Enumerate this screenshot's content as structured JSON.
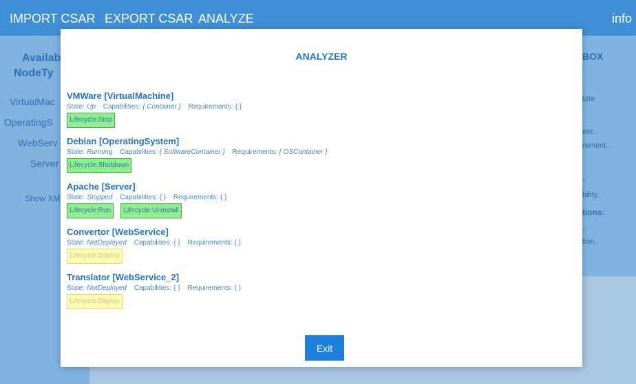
{
  "menu": {
    "import_label": "IMPORT CSAR",
    "export_label": "EXPORT CSAR",
    "analyze_label": "ANALYZE",
    "info_label": "info"
  },
  "left_panel": {
    "title_line1": "Availab",
    "title_line2": "NodeTy",
    "node_types": [
      "VirtualMac",
      "OperatingS",
      "WebServ",
      "Server"
    ],
    "show_xml_label": "Show XM"
  },
  "right_panel": {
    "title": "BOX",
    "items": [
      "tate",
      "ent..",
      "rement..",
      "..",
      "bility..",
      "tions:",
      "..",
      "tion.."
    ]
  },
  "modal": {
    "title": "ANALYZER",
    "state_label": "State:",
    "capabilities_label": "Capabilities:",
    "requirements_label": "Requirements:",
    "nodes": [
      {
        "name": "VMWare [VirtualMachine]",
        "state": "Up",
        "capabilities": "{ Container }",
        "requirements": "{ }",
        "actions": [
          {
            "label": "Lifecycle:Stop"
          }
        ]
      },
      {
        "name": "Debian [OperatingSystem]",
        "state": "Running",
        "capabilities": "{ SoftwareContainer }",
        "requirements": "{ OSContainer }",
        "actions": [
          {
            "label": "Lifecycle:Shutdown"
          }
        ]
      },
      {
        "name": "Apache [Server]",
        "state": "Stopped",
        "capabilities": "{ }",
        "requirements": "{ }",
        "actions": [
          {
            "label": "Lifecycle:Run"
          },
          {
            "label": "Lifecycle:Uninstall"
          }
        ]
      },
      {
        "name": "Convertor [WebService]",
        "state": "NotDeployed",
        "capabilities": "{ }",
        "requirements": "{ }",
        "actions": [
          {
            "label": "Lifecycle:Deploy"
          }
        ]
      },
      {
        "name": "Translator [WebService_2]",
        "state": "NotDeployed",
        "capabilities": "{ }",
        "requirements": "{ }",
        "actions": [
          {
            "label": "Lifecycle:Deploy"
          }
        ]
      }
    ],
    "exit_label": "Exit"
  }
}
